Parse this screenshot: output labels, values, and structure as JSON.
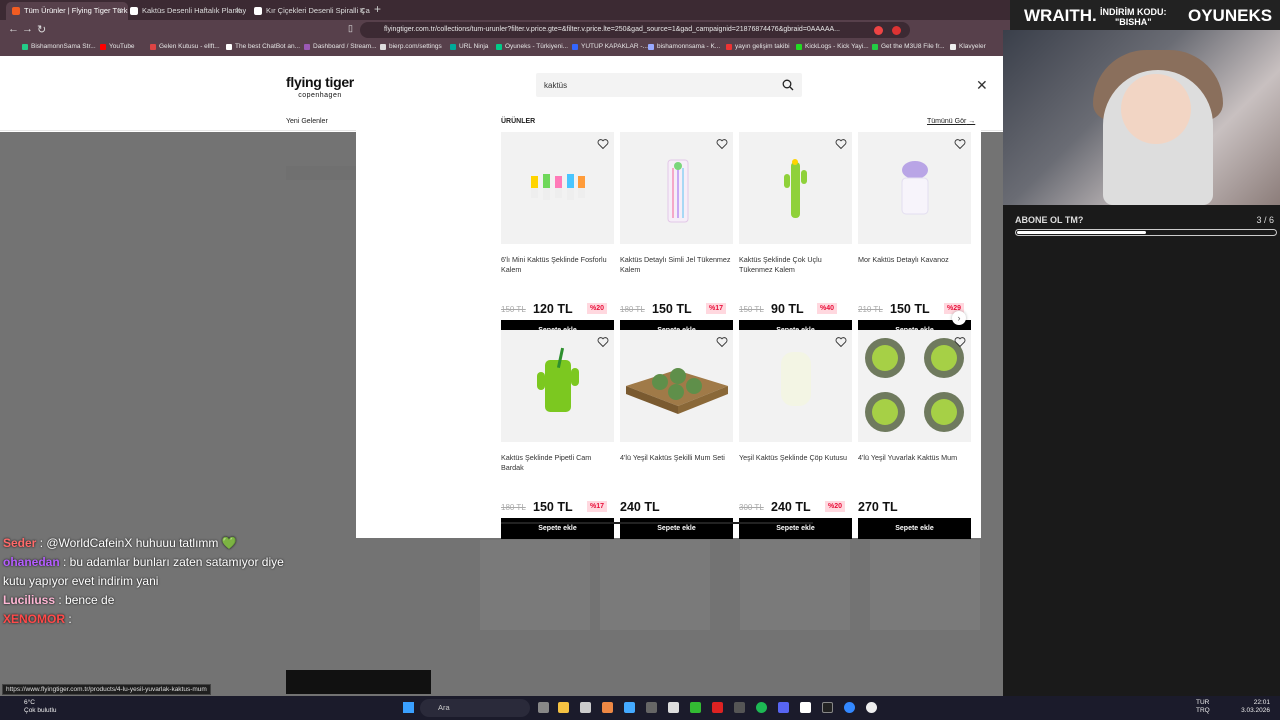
{
  "browser": {
    "tabs": [
      {
        "title": "Tüm Ürünler | Flying Tiger Türk..."
      },
      {
        "title": "Kaktüs Desenli Haftalık Planlayıcı | Fly"
      },
      {
        "title": "Kır Çiçekleri Desenli Spiralli Çalışma"
      }
    ],
    "url": "flyingtiger.com.tr/collections/tum-urunler?filter.v.price.gte=&filter.v.price.lte=250&gad_source=1&gad_campaignid=21876874476&gbraid=0AAAAA...",
    "bookmarks": [
      "BishamonnSama Str...",
      "YouTube",
      "Gelen Kutusu - ellft...",
      "The best ChatBot an...",
      "Dashboard / Stream...",
      "bierp.com/settings",
      "URL Ninja",
      "Oyuneks - Türkiyeni...",
      "YUTUP KAPAKLAR -...",
      "bishamonnsama - K...",
      "yayın gelişim takibi",
      "KickLogs - Kick Yayi...",
      "Get the M3U8 File fr...",
      "Klavyeler"
    ],
    "status_url": "https://www.flyingtiger.com.tr/products/4-lu-yesil-yuvarlak-kaktus-mum"
  },
  "site": {
    "logo": "flying tiger",
    "logo_sub": "copenhagen",
    "nav_new": "Yeni Gelenler"
  },
  "search": {
    "query": "kaktüs",
    "section_title": "ÜRÜNLER",
    "see_all": "Tümünü Gör"
  },
  "products": [
    {
      "name": "6'lı Mini Kaktüs Şeklinde Fosforlu Kalem",
      "old": "150 TL",
      "price": "120 TL",
      "discount": "%20",
      "button": "Sepete ekle"
    },
    {
      "name": "Kaktüs Detaylı Simli Jel Tükenmez Kalem",
      "old": "180 TL",
      "price": "150 TL",
      "discount": "%17",
      "button": "Sepete ekle"
    },
    {
      "name": "Kaktüs Şeklinde Çok Uçlu Tükenmez Kalem",
      "old": "150 TL",
      "price": "90 TL",
      "discount": "%40",
      "button": "Sepete ekle"
    },
    {
      "name": "Mor Kaktüs Detaylı Kavanoz",
      "old": "210 TL",
      "price": "150 TL",
      "discount": "%29",
      "button": "Sepete ekle"
    },
    {
      "name": "Kaktüs Şeklinde Pipetli Cam Bardak",
      "old": "180 TL",
      "price": "150 TL",
      "discount": "%17",
      "button": "Sepete ekle"
    },
    {
      "name": "4'lü Yeşil Kaktüs Şekilli Mum Seti",
      "old": "",
      "price": "240 TL",
      "discount": "",
      "button": "Sepete ekle"
    },
    {
      "name": "Yeşil Kaktüs Şeklinde Çöp Kutusu",
      "old": "300 TL",
      "price": "240 TL",
      "discount": "%20",
      "button": "Sepete ekle"
    },
    {
      "name": "4'lü Yeşil Yuvarlak Kaktüs Mum",
      "old": "",
      "price": "270 TL",
      "discount": "",
      "button": "Sepete ekle"
    }
  ],
  "stream": {
    "sponsor": "WRAITH.",
    "code_label": "İNDİRİM KODU:",
    "code_value": "\"BISHA\"",
    "brand": "OYUNEKS",
    "poll_question": "ABONE OL TM?",
    "poll_count": "3 / 6",
    "poll_progress": 0.5,
    "chat": [
      {
        "user": "Seder",
        "text": ": @WorldCafeinX huhuuu tatlımm 💚",
        "color": "#ff6a6a"
      },
      {
        "user": "ohanedan",
        "text": ": bu adamlar bunları zaten satamıyor diye kutu yapıyor evet indirim yani",
        "color": "#b45cff"
      },
      {
        "user": "Luciliuss",
        "text": ": bence de",
        "color": "#ffb7d5"
      },
      {
        "user": "XENOMOR",
        "text": ":",
        "color": "#ff4a4a"
      }
    ]
  },
  "taskbar": {
    "weather_temp": "6°C",
    "weather_desc": "Çok bulutlu",
    "search": "Ara",
    "lang": "TUR",
    "lang2": "TRQ",
    "time": "22:01",
    "date": "3.03.2026"
  }
}
